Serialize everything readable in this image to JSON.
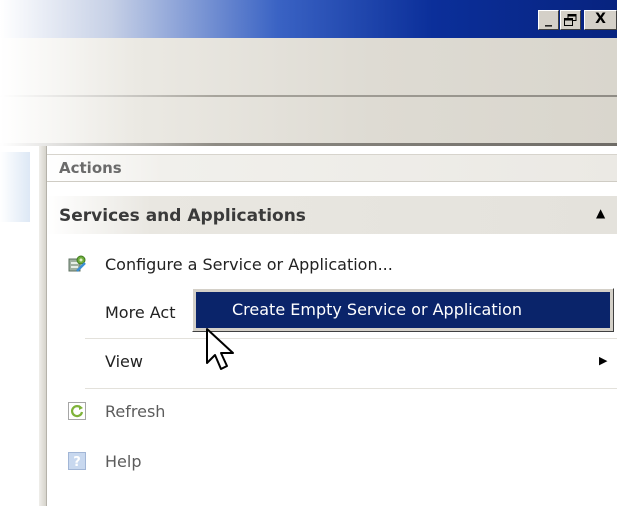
{
  "window": {
    "controls": {
      "minimize_label": "_",
      "maximize_label": "🗗",
      "close_label": "X"
    }
  },
  "actions_pane": {
    "header": "Actions",
    "section": {
      "title": "Services and Applications",
      "collapse_icon": "triangle-up-icon"
    },
    "items": [
      {
        "label": "Configure a Service or Application...",
        "icon": "configure-service-icon"
      },
      {
        "label": "More Act",
        "icon": ""
      },
      {
        "label": "View",
        "icon": "",
        "submenu_icon": "triangle-right-icon"
      },
      {
        "label": "Refresh",
        "icon": "refresh-icon"
      },
      {
        "label": "Help",
        "icon": "help-icon"
      }
    ]
  },
  "context_menu": {
    "items": [
      {
        "label": "Create Empty Service or Application"
      }
    ]
  },
  "colors": {
    "menu_highlight": "#0a246a",
    "titlebar_dark": "#0b2f9a"
  }
}
